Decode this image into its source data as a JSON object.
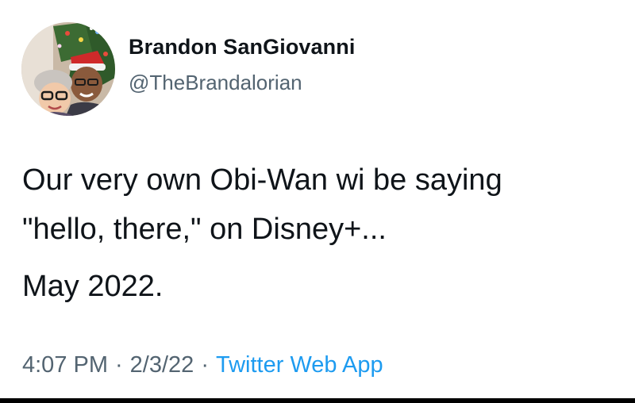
{
  "author": {
    "display_name": "Brandon SanGiovanni",
    "handle": "@TheBrandalorian",
    "avatar_icon": "profile-photo-avatar"
  },
  "tweet": {
    "lines": [
      "Our very own Obi-Wan wi be saying",
      "\"hello, there,\" on Disney+..."
    ],
    "date_line": "May 2022."
  },
  "meta": {
    "time": "4:07 PM",
    "separator": "·",
    "date": "2/3/22",
    "source": "Twitter Web App",
    "source_color": "#1d9bf0",
    "text_color": "#536471"
  }
}
